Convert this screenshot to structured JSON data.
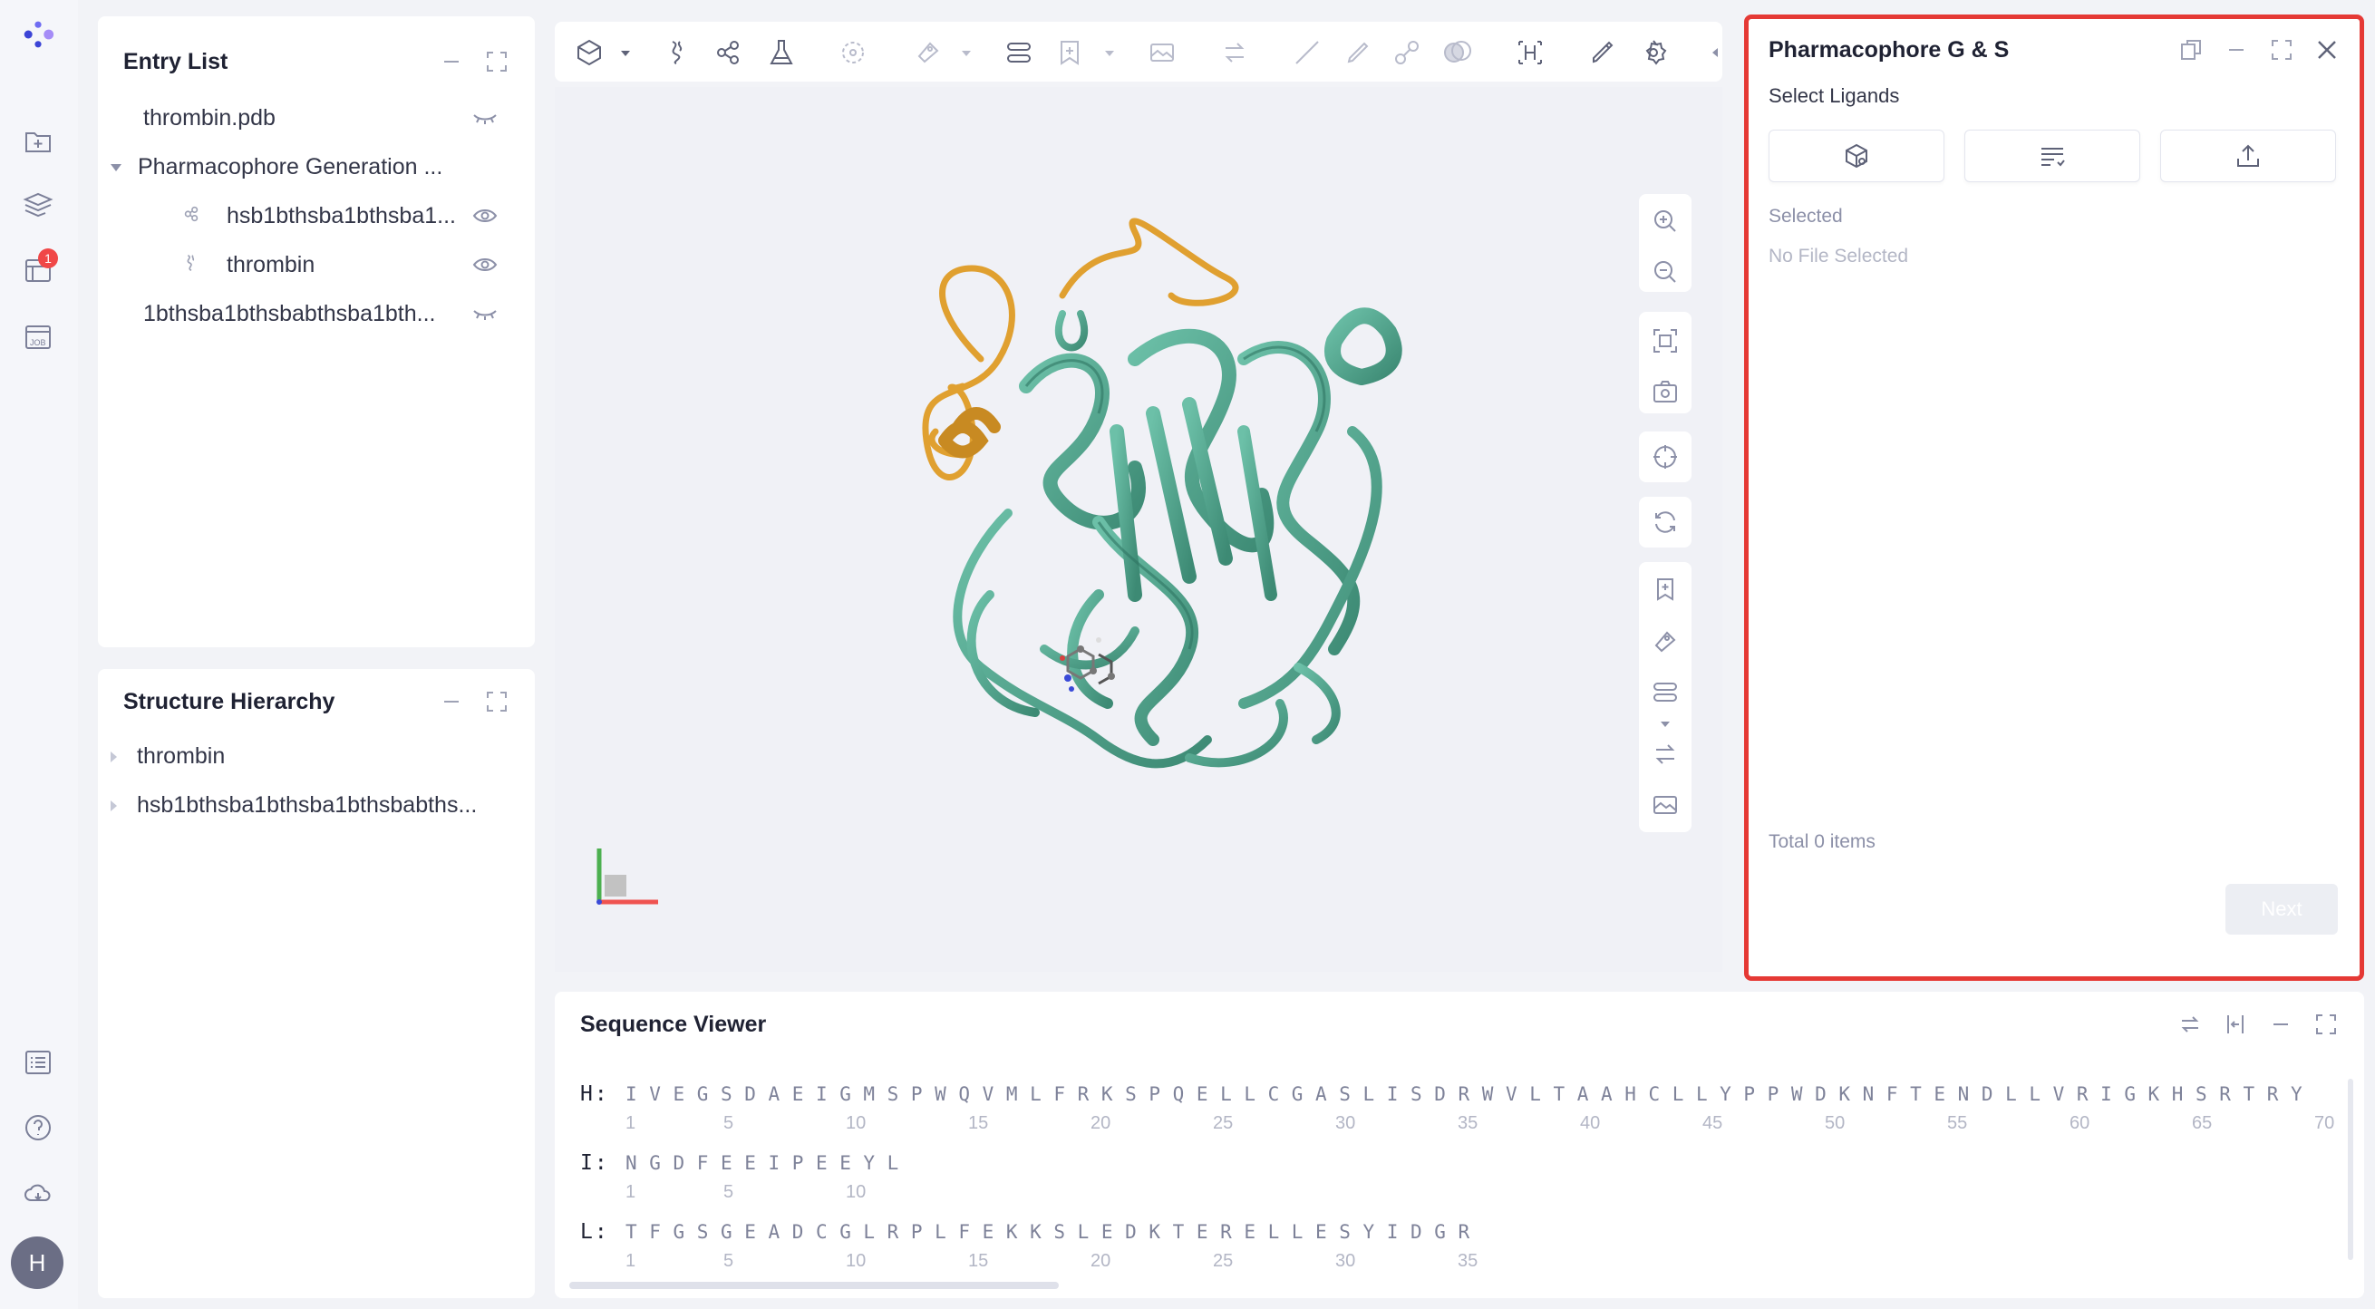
{
  "rail": {
    "badge_count": "1",
    "avatar_initial": "H"
  },
  "entry_list": {
    "title": "Entry List",
    "items": [
      {
        "label": "thrombin.pdb"
      },
      {
        "label": "Pharmacophore Generation ..."
      },
      {
        "label": "hsb1bthsba1bthsba1..."
      },
      {
        "label": "thrombin"
      },
      {
        "label": "1bthsba1bthsbabthsba1bth..."
      }
    ]
  },
  "structure_hierarchy": {
    "title": "Structure Hierarchy",
    "items": [
      {
        "label": "thrombin"
      },
      {
        "label": "hsb1bthsba1bthsba1bthsbabths..."
      }
    ]
  },
  "right_panel": {
    "title": "Pharmacophore G & S",
    "select_ligands_label": "Select Ligands",
    "selected_label": "Selected",
    "no_file_text": "No File Selected",
    "total_text": "Total 0 items",
    "next_button": "Next"
  },
  "sequence_viewer": {
    "title": "Sequence Viewer",
    "chains": [
      {
        "label": "H:",
        "residues": "IVEGSDAEIGMSPWQVMLFRKSPQELLCGASLISDRWVLTAAHCLLYPPWDKNFTENDLLVRIGKHSRTRY",
        "numbers": [
          "1",
          "5",
          "10",
          "15",
          "20",
          "25",
          "30",
          "35",
          "40",
          "45",
          "50",
          "55",
          "60",
          "65",
          "70"
        ]
      },
      {
        "label": "I:",
        "residues": "NGDFEEIPEEYL",
        "numbers": [
          "1",
          "5",
          "10"
        ]
      },
      {
        "label": "L:",
        "residues": "TFGSGEADCGLRPLFEKKSLEDKTERELLESYIDGR",
        "numbers": [
          "1",
          "5",
          "10",
          "15",
          "20",
          "25",
          "30",
          "35"
        ]
      }
    ]
  },
  "colors": {
    "protein_ribbon": "#5aaa93",
    "highlight_ribbon": "#e0a030",
    "accent_border": "#e53935",
    "brand": "#6a63e8"
  },
  "icons": {
    "rail": [
      "logo-icon",
      "new-folder-icon",
      "layers-icon",
      "task-list-icon",
      "job-icon",
      "list-icon",
      "help-icon",
      "cloud-icon"
    ],
    "toolbar": [
      "hexagon-icon",
      "dna-icon",
      "molecule-icon",
      "flask-icon",
      "target-icon",
      "tag-icon",
      "align-icon",
      "bookmark-icon",
      "image-icon",
      "swap-icon",
      "line-icon",
      "pen-icon",
      "link-icon",
      "surface-icon",
      "hbond-icon",
      "brush-icon",
      "settings-icon"
    ]
  }
}
